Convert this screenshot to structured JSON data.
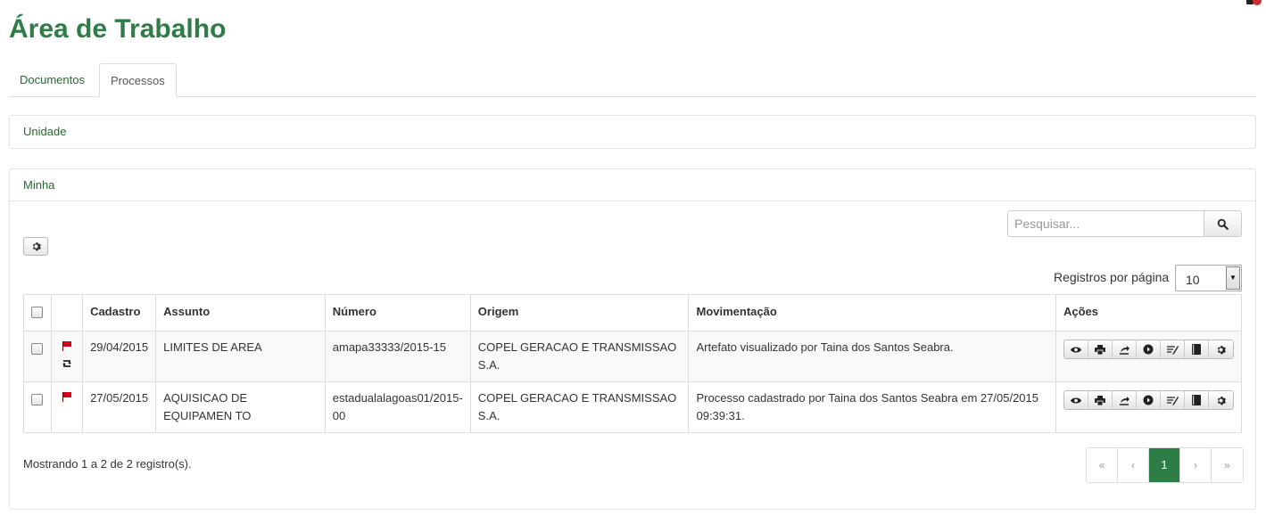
{
  "page": {
    "title": "Área de Trabalho"
  },
  "tabs": [
    {
      "label": "Documentos",
      "active": false
    },
    {
      "label": "Processos",
      "active": true
    }
  ],
  "panels": {
    "unidade": {
      "label": "Unidade"
    },
    "minha": {
      "label": "Minha"
    }
  },
  "search": {
    "placeholder": "Pesquisar..."
  },
  "per_page": {
    "label": "Registros por página",
    "value": "10"
  },
  "table": {
    "headers": [
      "Cadastro",
      "Assunto",
      "Número",
      "Origem",
      "Movimentação",
      "Ações"
    ],
    "rows": [
      {
        "cadastro": "29/04/2015",
        "assunto": "LIMITES DE AREA",
        "numero": "amapa33333/2015-15",
        "origem": "COPEL GERACAO E TRANSMISSAO S.A.",
        "movimentacao": "Artefato visualizado por Taina dos Santos Seabra."
      },
      {
        "cadastro": "27/05/2015",
        "assunto": "AQUISICAO DE EQUIPAMEN TO",
        "numero": "estadualalagoas01/2015-00",
        "origem": "COPEL GERACAO E TRANSMISSAO S.A.",
        "movimentacao": "Processo cadastrado por Taina dos Santos Seabra em 27/05/2015 09:39:31."
      }
    ],
    "action_icons": [
      "eye-icon",
      "print-icon",
      "forward-icon",
      "play-icon",
      "sign-icon",
      "book-icon",
      "gear-icon"
    ]
  },
  "footer": {
    "showing": "Mostrando 1 a 2 de 2 registro(s).",
    "pagination": {
      "first": "«",
      "prev": "‹",
      "current": "1",
      "next": "›",
      "last": "»"
    }
  },
  "colors": {
    "brand": "#2e7d46",
    "flag": "#d0021b",
    "notification": "#c9302c"
  }
}
